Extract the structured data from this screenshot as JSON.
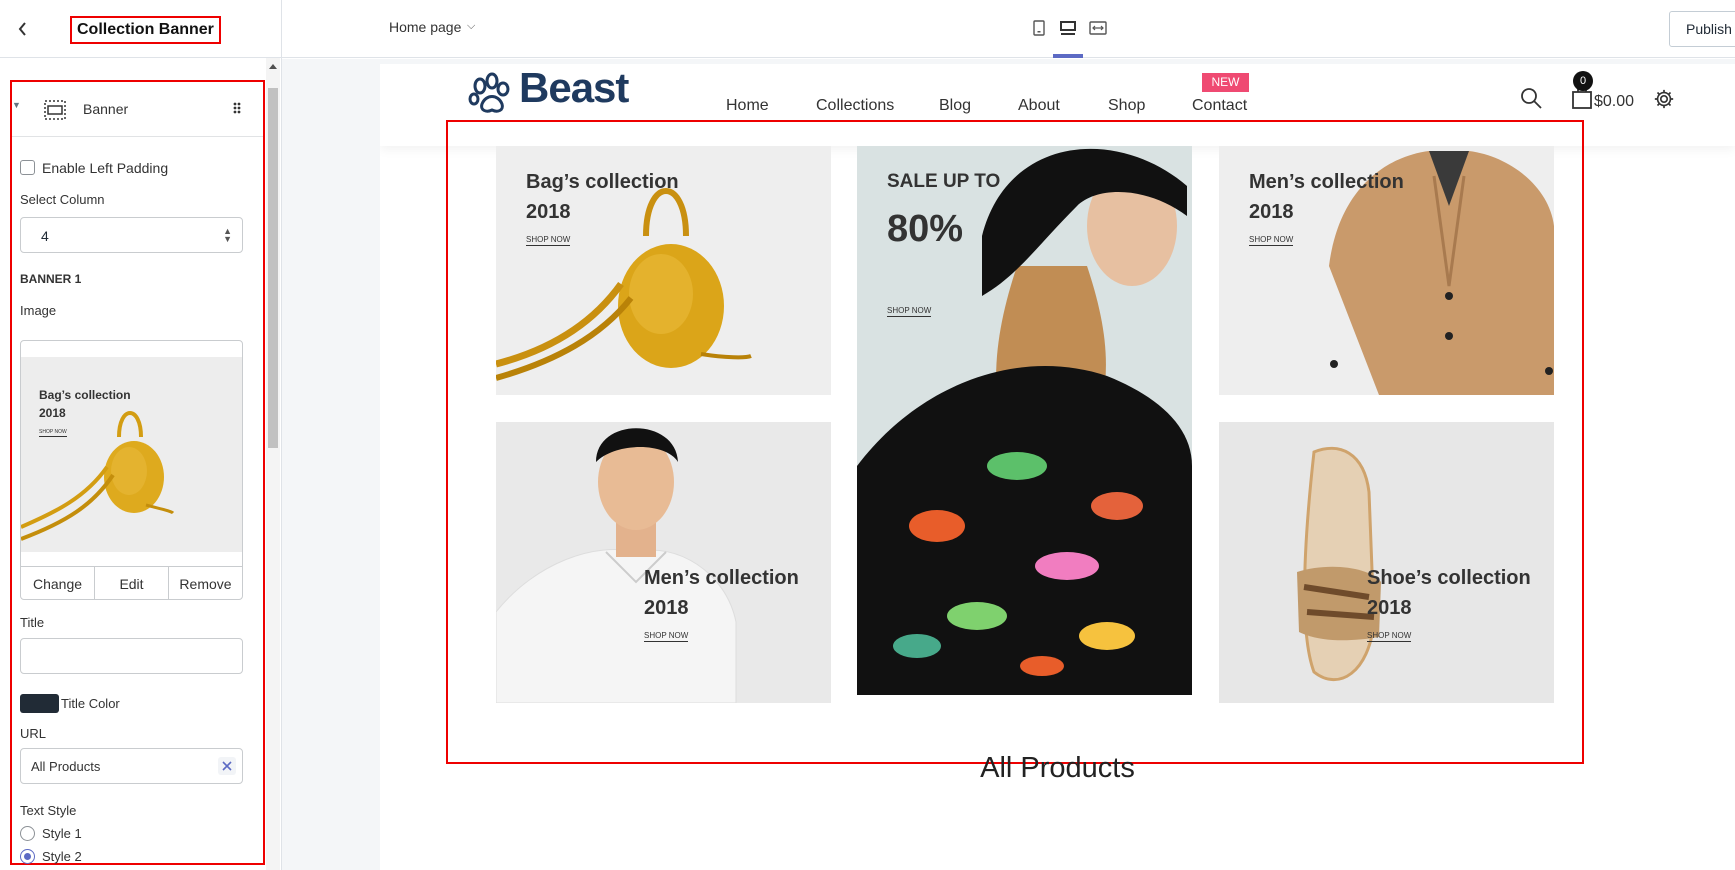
{
  "sidebar": {
    "title": "Collection Banner",
    "block_label": "Banner",
    "enable_left_padding": "Enable Left Padding",
    "select_column_label": "Select Column",
    "select_column_value": "4",
    "section_heading": "BANNER 1",
    "image_label": "Image",
    "image_preview_title_1": "Bag’s collection",
    "image_preview_title_2": "2018",
    "image_preview_link": "SHOP NOW",
    "image_actions": {
      "change": "Change",
      "edit": "Edit",
      "remove": "Remove"
    },
    "title_label": "Title",
    "title_value": "",
    "title_color_label": "Title Color",
    "title_color": "#212b36",
    "url_label": "URL",
    "url_value": "All Products",
    "text_style_label": "Text Style",
    "style_1": "Style 1",
    "style_2": "Style 2",
    "selected_style": "Style 2"
  },
  "topbar": {
    "page_selector": "Home page",
    "view_modes": [
      "mobile-icon",
      "desktop-icon",
      "fullwidth-icon"
    ],
    "active_view": "desktop-icon",
    "publish": "Publish"
  },
  "store": {
    "logo": "Beast",
    "nav": [
      "Home",
      "Collections",
      "Blog",
      "About",
      "Shop",
      "Contact"
    ],
    "nav_badge": "NEW",
    "cart_count": "0",
    "cart_total": "$0.00",
    "banners": [
      {
        "title_1": "Bag’s collection",
        "title_2": "2018",
        "link": "SHOP NOW"
      },
      {
        "title_1": "SALE UP TO",
        "title_2": "80%",
        "link": "SHOP NOW"
      },
      {
        "title_1": "Men’s collection",
        "title_2": "2018",
        "link": "SHOP NOW"
      },
      {
        "title_1": "Men’s collection",
        "title_2": "2018",
        "link": "SHOP NOW"
      },
      {
        "title_1": "Shoe’s collection",
        "title_2": "2018",
        "link": "SHOP NOW"
      }
    ],
    "section_title": "All Products"
  },
  "colors": {
    "accent": "#5c6ac4",
    "highlight": "#ee0000",
    "badge": "#ef4a72",
    "logo": "#1f3a5f"
  }
}
